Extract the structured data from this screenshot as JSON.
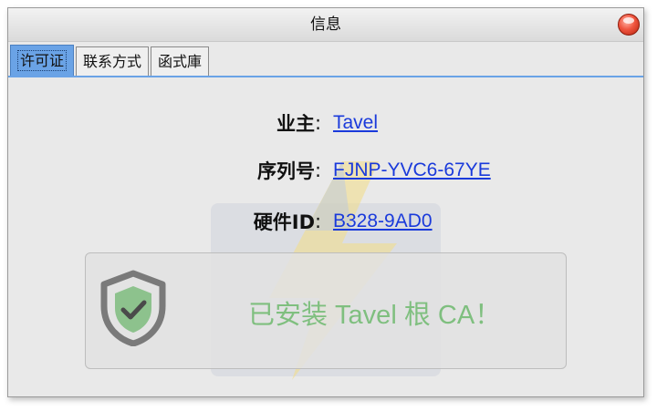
{
  "window": {
    "title": "信息"
  },
  "tabs": [
    {
      "label": "许可证",
      "active": true
    },
    {
      "label": "联系方式",
      "active": false
    },
    {
      "label": "函式庫",
      "active": false
    }
  ],
  "license": {
    "owner_label": "业主",
    "owner_value": "Tavel",
    "serial_label": "序列号",
    "serial_value": "FJNP-YVC6-67YE",
    "hardware_label": "硬件ID",
    "hardware_value": "B328-9AD0",
    "separator": ":"
  },
  "notice": {
    "message": "已安装 Tavel 根 CA！",
    "icon": "shield-check-icon",
    "color": "#7fbf7f"
  },
  "colors": {
    "tab_active": "#6aa3e6",
    "link": "#1a3adb",
    "close": "#f0553f"
  }
}
